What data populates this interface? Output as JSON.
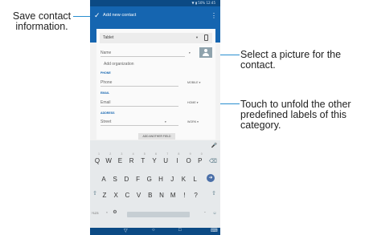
{
  "annotations": {
    "save": "Save contact information.",
    "picture": "Select a picture for the contact.",
    "labels": "Touch to unfold the other predefined labels of this category."
  },
  "status_bar": {
    "text": "▼ ▮ 50% 12:45"
  },
  "app_bar": {
    "title": "Add new contact",
    "save_icon": "check-icon",
    "menu_icon": "more-vert-icon"
  },
  "form": {
    "account": "Tablet",
    "name_placeholder": "Name",
    "add_org": "Add organization",
    "phone_section": "PHONE",
    "phone_placeholder": "Phone",
    "phone_label": "MOBILE ▾",
    "email_section": "EMAIL",
    "email_placeholder": "Email",
    "email_label": "HOME ▾",
    "address_section": "ADDRESS",
    "street_placeholder": "Street",
    "address_label": "WORK ▾",
    "add_field": "ADD ANOTHER FIELD"
  },
  "keyboard": {
    "numbers": [
      "1",
      "2",
      "3",
      "4",
      "5",
      "6",
      "7",
      "8",
      "9",
      "0"
    ],
    "row1": [
      "Q",
      "W",
      "E",
      "R",
      "T",
      "Y",
      "U",
      "I",
      "O",
      "P"
    ],
    "row2": [
      "A",
      "S",
      "D",
      "F",
      "G",
      "H",
      "J",
      "K",
      "L"
    ],
    "row3": [
      "Z",
      "X",
      "C",
      "V",
      "B",
      "N",
      "M",
      "!",
      "?"
    ],
    "symbols_key": "?123",
    "comma": ",",
    "period": "."
  },
  "colors": {
    "primary": "#1565b0",
    "status": "#0c4a84",
    "annotation_line": "#2a8fd0"
  }
}
